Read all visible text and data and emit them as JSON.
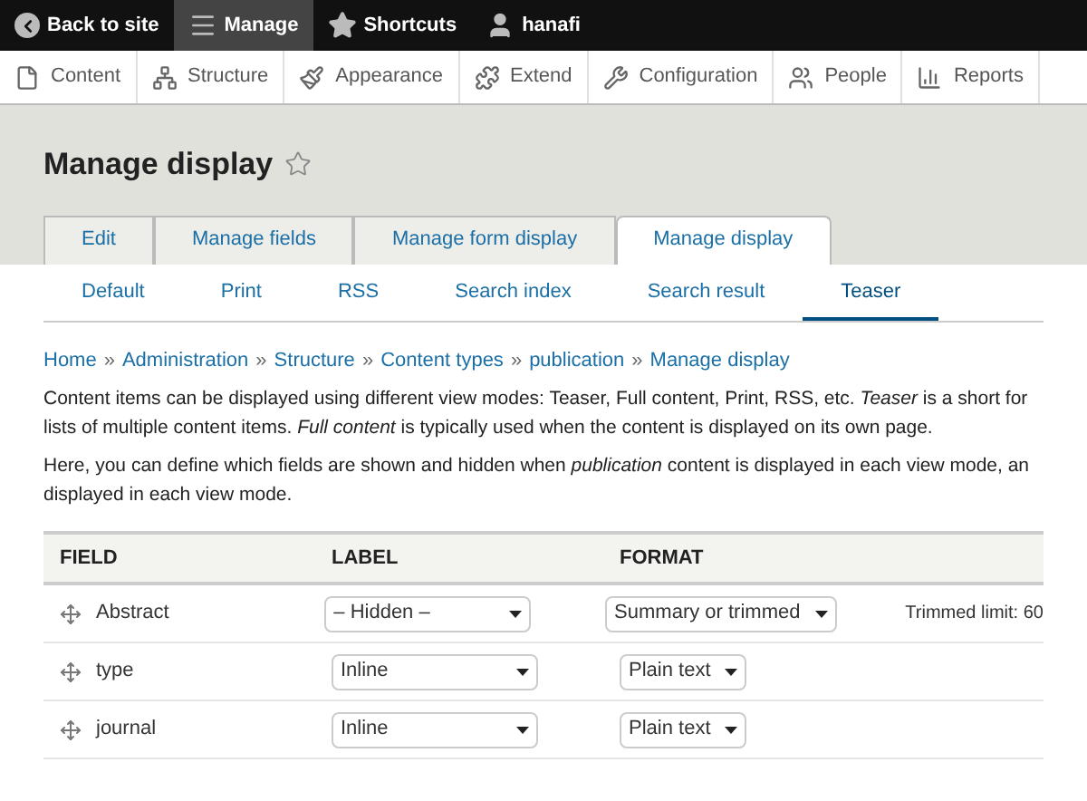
{
  "toolbar": [
    {
      "label": "Back to site",
      "selected": false
    },
    {
      "label": "Manage",
      "selected": true
    },
    {
      "label": "Shortcuts",
      "selected": false
    },
    {
      "label": "hanafi",
      "selected": false
    }
  ],
  "admin_menu": [
    "Content",
    "Structure",
    "Appearance",
    "Extend",
    "Configuration",
    "People",
    "Reports"
  ],
  "page_title": "Manage display",
  "primary_tabs": [
    {
      "label": "Edit",
      "selected": false
    },
    {
      "label": "Manage fields",
      "selected": false
    },
    {
      "label": "Manage form display",
      "selected": false
    },
    {
      "label": "Manage display",
      "selected": true
    }
  ],
  "secondary_tabs": [
    {
      "label": "Default",
      "selected": false
    },
    {
      "label": "Print",
      "selected": false
    },
    {
      "label": "RSS",
      "selected": false
    },
    {
      "label": "Search index",
      "selected": false
    },
    {
      "label": "Search result",
      "selected": false
    },
    {
      "label": "Teaser",
      "selected": true
    }
  ],
  "breadcrumb": [
    "Home",
    "Administration",
    "Structure",
    "Content types",
    "publication",
    "Manage display"
  ],
  "breadcrumb_separator": "»",
  "paragraphs": [
    "Content items can be displayed using different view modes: Teaser, Full content, Print, RSS, etc. *Teaser* is a short for lists of multiple content items. *Full content* is typically used when the content is displayed on its own page.",
    "Here, you can define which fields are shown and hidden when *publication* content is displayed in each view mode, an displayed in each view mode."
  ],
  "table": {
    "columns": [
      "FIELD",
      "LABEL",
      "FORMAT"
    ],
    "rows": [
      {
        "field": "Abstract",
        "label": "– Hidden –",
        "format": "Summary or trimmed",
        "summary": "Trimmed limit: 60"
      },
      {
        "field": "type",
        "label": "Inline",
        "format": "Plain text"
      },
      {
        "field": "journal",
        "label": "Inline",
        "format": "Plain text"
      }
    ]
  }
}
